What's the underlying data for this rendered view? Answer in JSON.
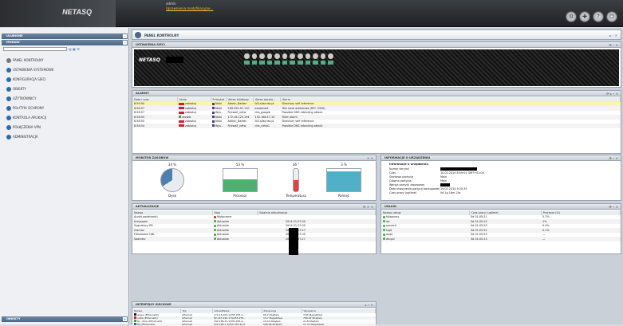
{
  "topbar": {
    "logo": "NETASQ",
    "user_name": "admin",
    "user_link": "Uprawnienia modyfikacyjne...",
    "icons": [
      "shield-icon",
      "tools-icon",
      "help-icon",
      "logout-icon"
    ]
  },
  "sidebar": {
    "header1": "ULUBIONE",
    "header2": "MODUŁY",
    "items": [
      {
        "label": "PANEL KONTROLNY"
      },
      {
        "label": "USTAWIENIA SYSTEMOWE"
      },
      {
        "label": "KONFIGURACJA SIECI"
      },
      {
        "label": "OBIEKTY"
      },
      {
        "label": "UŻYTKOWNICY"
      },
      {
        "label": "POLITYKI OCHRONY"
      },
      {
        "label": "KONTROLA APLIKACJI"
      },
      {
        "label": "POŁĄCZENIA VPN"
      },
      {
        "label": "ADMINISTRACJA"
      }
    ],
    "bottom": "OBIEKTY"
  },
  "main": {
    "title": "PANEL KONTROLNY",
    "network_title": "USTAWIENIA SIECI",
    "device_logo": "NETASQ",
    "alarms": {
      "title": "ALARMY",
      "columns": [
        "Data i czas",
        "Akcja",
        "Priorytet",
        "Adres źródłowy",
        "Adres docelo...",
        "Alarm"
      ],
      "rows": [
        [
          "8:59:00",
          "zablokuj",
          "Niski",
          "Admin_Barten",
          "lb3.sdscriss.pl",
          "Directory self reference"
        ],
        [
          "8:58:57",
          "zablokuj",
          "Niski",
          "169.254.91.110",
          "broadcast",
          "Teln local addresses (RFC 3330)"
        ],
        [
          "8:58:57",
          "zablokuj",
          "Wys...",
          "Firewall_netw",
          "dns_google",
          "Possible DNS rebinding attack"
        ],
        [
          "8:58:55",
          "zezwól",
          "Niski",
          "172.16.120.194",
          "192.168.17.10",
          "Filter alarm"
        ],
        [
          "8:58:55",
          "zablokuj",
          "Niski",
          "Admin_Barten",
          "lb3.sdscriss.pl",
          "Directory self reference"
        ],
        [
          "8:58:54",
          "zablokuj",
          "Wys...",
          "Firewall_netw",
          "dns_netia1",
          "Possible DNS rebinding attack"
        ]
      ]
    },
    "monitor": {
      "title": "MONITOR ZASOBÓW",
      "items": [
        {
          "pct": "34 %",
          "label": "Dysk"
        },
        {
          "pct": "53 %",
          "label": "Procesor"
        },
        {
          "pct": "36 °",
          "label": "Temperatura"
        },
        {
          "pct": "3 %",
          "label": "Pamięć"
        }
      ]
    },
    "updates": {
      "title": "AKTUALIZACJE",
      "columns": [
        "Nazwa",
        "Stan",
        "Ostatnia aktualizacja"
      ],
      "rows": [
        [
          "Audyt podatności",
          "Wyłączone",
          ""
        ],
        [
          "Antyspam",
          "Aktualne",
          "2014.21.07:00"
        ],
        [
          "Sygnatury IPS",
          "Aktualne",
          "2014.21.07:00"
        ],
        [
          "Clamav",
          "Aktualne",
          "2014.21.07:27"
        ],
        [
          "Filtrowanie URL",
          "Aktualne",
          "2014.21.07:00"
        ],
        [
          "Vadretro",
          "Aktualne",
          "2014.21.07:27"
        ]
      ]
    },
    "device_info": {
      "title": "INFORMACJE O URZĄDZENIU",
      "section": "Informacje o urządzeniu",
      "rows": [
        {
          "k": "Numer seryjny",
          "v": ""
        },
        {
          "k": "Czas",
          "v": "10.02.2014 8:59:01 GMT+01:00"
        },
        {
          "k": "Startowa partycja",
          "v": "Main"
        },
        {
          "k": "Główna partycja",
          "v": "Main"
        },
        {
          "k": "Wersja partycji zapasowej",
          "v": ""
        },
        {
          "k": "Data utworzenia partycji backupowej",
          "v": "19.02.2014 9:20:35"
        },
        {
          "k": "Czas pracy (uptime)",
          "v": "0d 1g 16m 24s"
        }
      ]
    },
    "services": {
      "title": "USŁUGI",
      "columns": [
        "Nazwa usługi",
        "Czas pracy (uptime)",
        "Procesor (%)"
      ],
      "rows": [
        [
          "httpproxy",
          "5d 01:05:21",
          "5.7%"
        ],
        [
          "ssl",
          "5d 01:05:15",
          "1%"
        ],
        [
          "serverd",
          "5d 01:05:29",
          "0.4%"
        ],
        [
          "sigd",
          "5d 01:05:32",
          "0.1%"
        ],
        [
          "asqd",
          "5d 01:05:29",
          "—"
        ],
        [
          "dhcpd",
          "5d 01:05:13",
          "—"
        ]
      ]
    },
    "interfaces": {
      "title": "INTERFEJSY SIECIOWE",
      "columns": [
        "Nazwa",
        "Typ",
        "Adres/Maska",
        "Pobieranie",
        "Wysyłanie"
      ],
      "rows": [
        [
          "wewn (Ethernet0)",
          "ethernet",
          "172.16.204.1/255.255.2...",
          "66.7 Kbajta/s",
          "3.69 Megabita/s"
        ],
        [
          "netia (Ethernet1)",
          "ethernet",
          "82.233.194.179/255.255...",
          "13.7 Megabita/s",
          "789.02 Kbajta/s"
        ],
        [
          "tpr_dhcp (Ethernet2)",
          "ethernet",
          "192.168.21.1/255.255.2...",
          "15.14 Kbajta/s",
          "4.18 Kbajta/s"
        ],
        [
          "tpt (Ethernet1)",
          "ethernet",
          "192.168.1.3/255.255.25.0",
          "648.98 Kbajta/s",
          "11.75 Megabita/s"
        ]
      ]
    }
  },
  "colors": {
    "accent": "#4c6783",
    "alert_red": "#c22233",
    "ok_green": "#3aa53a",
    "highlight": "#fff3b0"
  }
}
